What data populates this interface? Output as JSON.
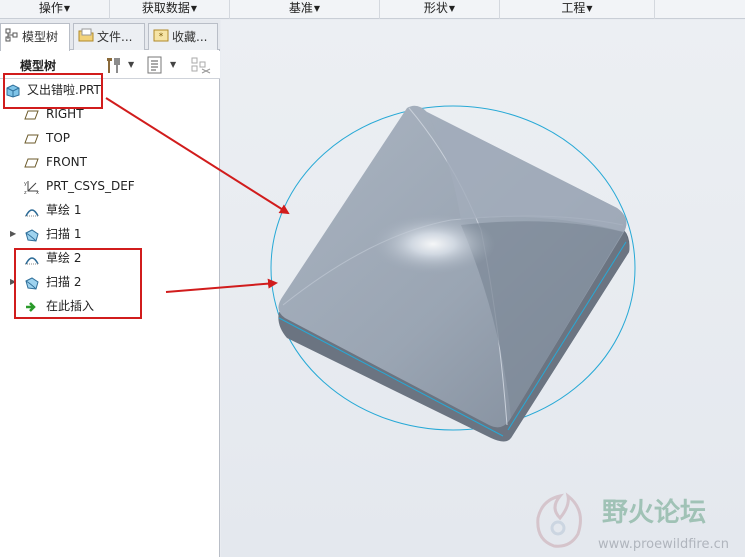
{
  "ribbon": {
    "groups": [
      {
        "label": "操作"
      },
      {
        "label": "获取数据"
      },
      {
        "label": "基准"
      },
      {
        "label": "形状"
      },
      {
        "label": "工程"
      }
    ]
  },
  "panel": {
    "tabs": [
      {
        "label": "模型树",
        "icon": "model-tree-icon"
      },
      {
        "label": "文件...",
        "icon": "folder-icon"
      },
      {
        "label": "收藏...",
        "icon": "favorites-icon"
      }
    ],
    "toolbar_title": "模型树"
  },
  "tree": {
    "root": {
      "label": "又出错啦.PRT",
      "icon": "part-icon"
    },
    "items": [
      {
        "label": "RIGHT",
        "icon": "datum-plane-icon",
        "expandable": false
      },
      {
        "label": "TOP",
        "icon": "datum-plane-icon",
        "expandable": false
      },
      {
        "label": "FRONT",
        "icon": "datum-plane-icon",
        "expandable": false
      },
      {
        "label": "PRT_CSYS_DEF",
        "icon": "coordinate-system-icon",
        "expandable": false
      },
      {
        "label": "草绘 1",
        "icon": "sketch-icon",
        "expandable": false
      },
      {
        "label": "扫描 1",
        "icon": "sweep-icon",
        "expandable": true
      },
      {
        "label": "草绘 2",
        "icon": "sketch-icon",
        "expandable": false
      },
      {
        "label": "扫描 2",
        "icon": "sweep-icon",
        "expandable": true
      },
      {
        "label": "在此插入",
        "icon": "insert-here-icon",
        "expandable": false
      }
    ]
  },
  "watermark": {
    "text": "野火论坛",
    "url": "www.proewildfire.cn"
  },
  "colors": {
    "annotation": "#d11c1c",
    "sketch_curve": "#27a9d6",
    "model_shade": "#8d99a8"
  }
}
